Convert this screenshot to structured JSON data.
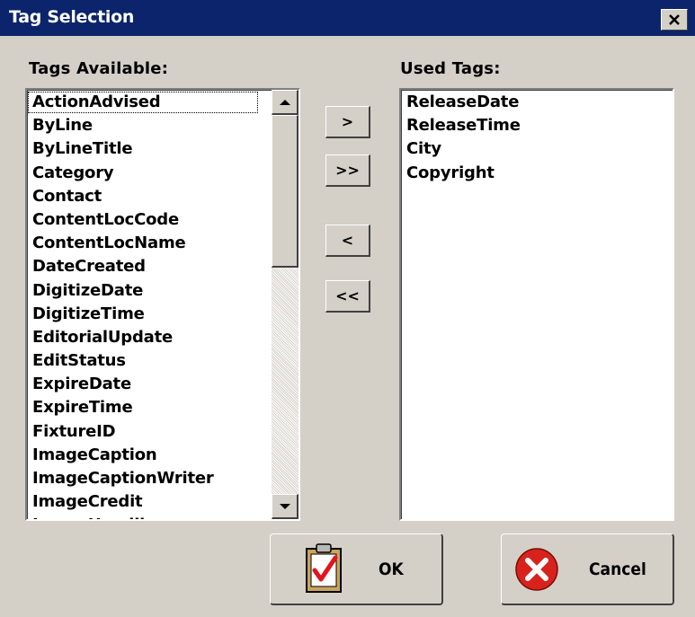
{
  "window": {
    "title": "Tag Selection",
    "close_glyph": "✕"
  },
  "available": {
    "label": "Tags Available:",
    "items": [
      "ActionAdvised",
      "ByLine",
      "ByLineTitle",
      "Category",
      "Contact",
      "ContentLocCode",
      "ContentLocName",
      "DateCreated",
      "DigitizeDate",
      "DigitizeTime",
      "EditorialUpdate",
      "EditStatus",
      "ExpireDate",
      "ExpireTime",
      "FixtureID",
      "ImageCaption",
      "ImageCaptionWriter",
      "ImageCredit",
      "ImageHeadline"
    ],
    "focused_index": 0
  },
  "used": {
    "label": "Used Tags:",
    "items": [
      "ReleaseDate",
      "ReleaseTime",
      "City",
      "Copyright"
    ]
  },
  "move_buttons": {
    "add_one": ">",
    "add_all": ">>",
    "remove_one": "<",
    "remove_all": "<<"
  },
  "ok_button": {
    "label": "OK",
    "icon": "clipboard-check-icon"
  },
  "cancel_button": {
    "label": "Cancel",
    "icon": "error-x-icon"
  },
  "colors": {
    "title_bar": "#0b246b",
    "dialog": "#d4d0c8",
    "cancel_red": "#d8231c"
  }
}
